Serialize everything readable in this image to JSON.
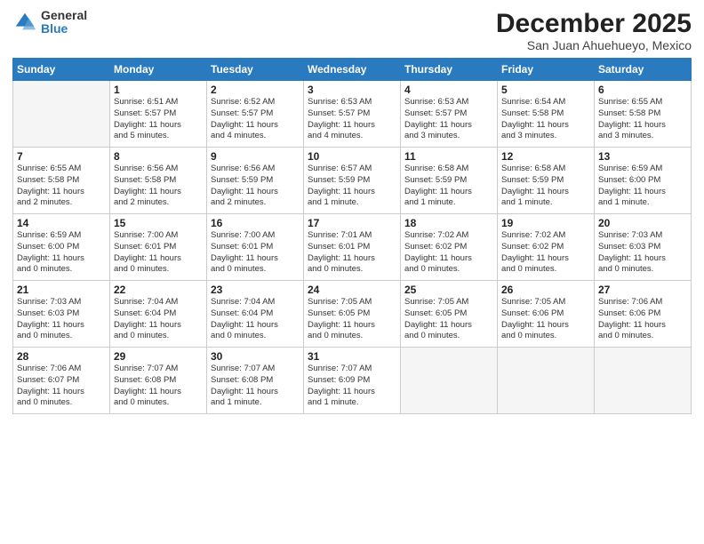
{
  "logo": {
    "general": "General",
    "blue": "Blue"
  },
  "title": "December 2025",
  "subtitle": "San Juan Ahuehueyo, Mexico",
  "days_header": [
    "Sunday",
    "Monday",
    "Tuesday",
    "Wednesday",
    "Thursday",
    "Friday",
    "Saturday"
  ],
  "weeks": [
    [
      {
        "num": "",
        "info": ""
      },
      {
        "num": "1",
        "info": "Sunrise: 6:51 AM\nSunset: 5:57 PM\nDaylight: 11 hours\nand 5 minutes."
      },
      {
        "num": "2",
        "info": "Sunrise: 6:52 AM\nSunset: 5:57 PM\nDaylight: 11 hours\nand 4 minutes."
      },
      {
        "num": "3",
        "info": "Sunrise: 6:53 AM\nSunset: 5:57 PM\nDaylight: 11 hours\nand 4 minutes."
      },
      {
        "num": "4",
        "info": "Sunrise: 6:53 AM\nSunset: 5:57 PM\nDaylight: 11 hours\nand 3 minutes."
      },
      {
        "num": "5",
        "info": "Sunrise: 6:54 AM\nSunset: 5:58 PM\nDaylight: 11 hours\nand 3 minutes."
      },
      {
        "num": "6",
        "info": "Sunrise: 6:55 AM\nSunset: 5:58 PM\nDaylight: 11 hours\nand 3 minutes."
      }
    ],
    [
      {
        "num": "7",
        "info": "Sunrise: 6:55 AM\nSunset: 5:58 PM\nDaylight: 11 hours\nand 2 minutes."
      },
      {
        "num": "8",
        "info": "Sunrise: 6:56 AM\nSunset: 5:58 PM\nDaylight: 11 hours\nand 2 minutes."
      },
      {
        "num": "9",
        "info": "Sunrise: 6:56 AM\nSunset: 5:59 PM\nDaylight: 11 hours\nand 2 minutes."
      },
      {
        "num": "10",
        "info": "Sunrise: 6:57 AM\nSunset: 5:59 PM\nDaylight: 11 hours\nand 1 minute."
      },
      {
        "num": "11",
        "info": "Sunrise: 6:58 AM\nSunset: 5:59 PM\nDaylight: 11 hours\nand 1 minute."
      },
      {
        "num": "12",
        "info": "Sunrise: 6:58 AM\nSunset: 5:59 PM\nDaylight: 11 hours\nand 1 minute."
      },
      {
        "num": "13",
        "info": "Sunrise: 6:59 AM\nSunset: 6:00 PM\nDaylight: 11 hours\nand 1 minute."
      }
    ],
    [
      {
        "num": "14",
        "info": "Sunrise: 6:59 AM\nSunset: 6:00 PM\nDaylight: 11 hours\nand 0 minutes."
      },
      {
        "num": "15",
        "info": "Sunrise: 7:00 AM\nSunset: 6:01 PM\nDaylight: 11 hours\nand 0 minutes."
      },
      {
        "num": "16",
        "info": "Sunrise: 7:00 AM\nSunset: 6:01 PM\nDaylight: 11 hours\nand 0 minutes."
      },
      {
        "num": "17",
        "info": "Sunrise: 7:01 AM\nSunset: 6:01 PM\nDaylight: 11 hours\nand 0 minutes."
      },
      {
        "num": "18",
        "info": "Sunrise: 7:02 AM\nSunset: 6:02 PM\nDaylight: 11 hours\nand 0 minutes."
      },
      {
        "num": "19",
        "info": "Sunrise: 7:02 AM\nSunset: 6:02 PM\nDaylight: 11 hours\nand 0 minutes."
      },
      {
        "num": "20",
        "info": "Sunrise: 7:03 AM\nSunset: 6:03 PM\nDaylight: 11 hours\nand 0 minutes."
      }
    ],
    [
      {
        "num": "21",
        "info": "Sunrise: 7:03 AM\nSunset: 6:03 PM\nDaylight: 11 hours\nand 0 minutes."
      },
      {
        "num": "22",
        "info": "Sunrise: 7:04 AM\nSunset: 6:04 PM\nDaylight: 11 hours\nand 0 minutes."
      },
      {
        "num": "23",
        "info": "Sunrise: 7:04 AM\nSunset: 6:04 PM\nDaylight: 11 hours\nand 0 minutes."
      },
      {
        "num": "24",
        "info": "Sunrise: 7:05 AM\nSunset: 6:05 PM\nDaylight: 11 hours\nand 0 minutes."
      },
      {
        "num": "25",
        "info": "Sunrise: 7:05 AM\nSunset: 6:05 PM\nDaylight: 11 hours\nand 0 minutes."
      },
      {
        "num": "26",
        "info": "Sunrise: 7:05 AM\nSunset: 6:06 PM\nDaylight: 11 hours\nand 0 minutes."
      },
      {
        "num": "27",
        "info": "Sunrise: 7:06 AM\nSunset: 6:06 PM\nDaylight: 11 hours\nand 0 minutes."
      }
    ],
    [
      {
        "num": "28",
        "info": "Sunrise: 7:06 AM\nSunset: 6:07 PM\nDaylight: 11 hours\nand 0 minutes."
      },
      {
        "num": "29",
        "info": "Sunrise: 7:07 AM\nSunset: 6:08 PM\nDaylight: 11 hours\nand 0 minutes."
      },
      {
        "num": "30",
        "info": "Sunrise: 7:07 AM\nSunset: 6:08 PM\nDaylight: 11 hours\nand 1 minute."
      },
      {
        "num": "31",
        "info": "Sunrise: 7:07 AM\nSunset: 6:09 PM\nDaylight: 11 hours\nand 1 minute."
      },
      {
        "num": "",
        "info": ""
      },
      {
        "num": "",
        "info": ""
      },
      {
        "num": "",
        "info": ""
      }
    ]
  ]
}
